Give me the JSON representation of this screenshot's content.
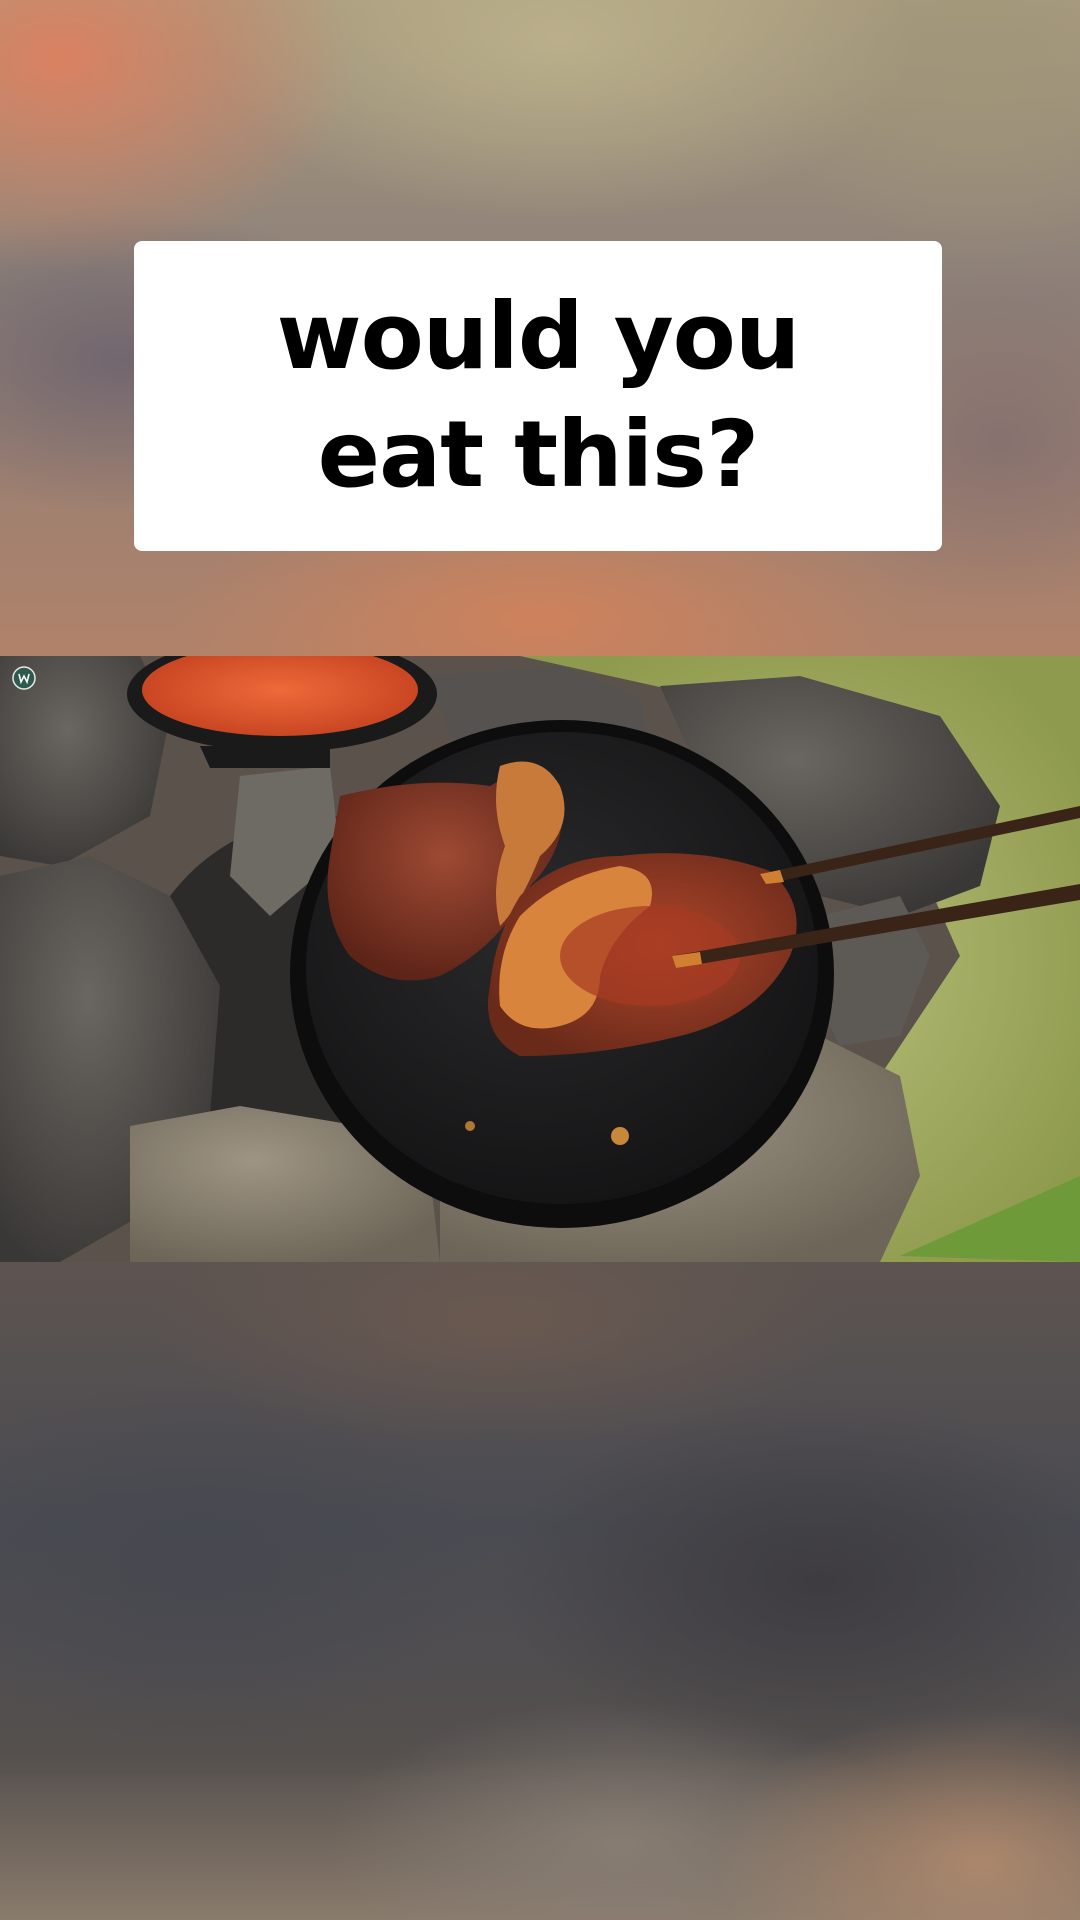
{
  "caption": {
    "line1": "would you",
    "line2": "eat this?"
  },
  "photo": {
    "watermark_icon": "channel-logo-icon",
    "colors": {
      "griddle": "#1c1c1e",
      "steak": "#8a3b2a",
      "sauce": "#d9502a",
      "grass": "#a9b56a",
      "rock": "#4e4b48"
    }
  }
}
